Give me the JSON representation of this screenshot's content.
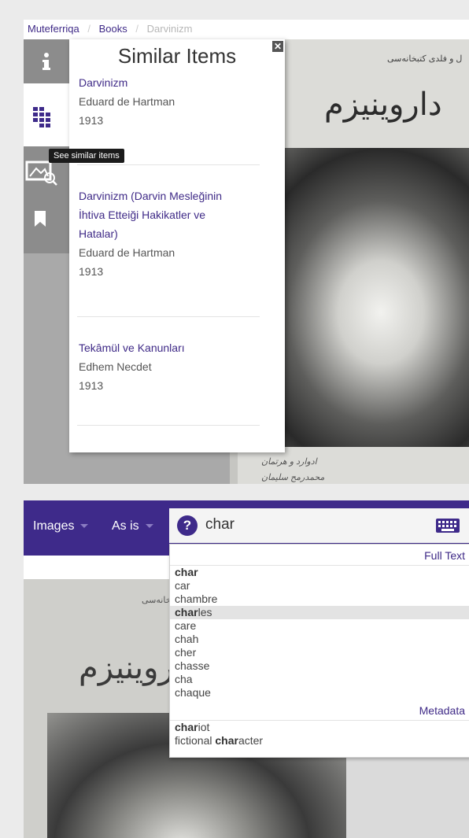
{
  "breadcrumb": {
    "home": "Muteferriqa",
    "section": "Books",
    "current": "Darvinizm",
    "separator": "/"
  },
  "sidebar": {
    "items": [
      {
        "icon": "info-icon"
      },
      {
        "icon": "similar-items-icon"
      },
      {
        "icon": "image-search-icon"
      },
      {
        "icon": "bookmark-icon"
      }
    ],
    "tooltip": "See similar items"
  },
  "similar_panel": {
    "title": "Similar Items",
    "close_label": "✕",
    "items": [
      {
        "title": "Darvinizm",
        "author": "Eduard de Hartman",
        "year": "1913"
      },
      {
        "title_lines": [
          "Darvinizm (Darvin Mesleğinin",
          "İhtiva Etteiği Hakikatler ve",
          "Hatalar)"
        ],
        "author": "Eduard de Hartman",
        "year": "1913"
      },
      {
        "title": "Tekâmül ve Kanunları",
        "author": "Edhem Necdet",
        "year": "1913"
      }
    ]
  },
  "book_page": {
    "title_arabic": "داروینیزم",
    "top_line_arabic": "ل و فلدی کتبخانه‌سی",
    "caption_line1": "ادوارد و هرتمان",
    "caption_line2": "محمدرمح سلیمان"
  },
  "toolbar": {
    "view_select": "Images",
    "mode_select": "As is",
    "help_label": "?",
    "keyboard_icon": "keyboard-icon"
  },
  "search": {
    "value": "char",
    "placeholder": "",
    "sections": [
      {
        "header": "Full Text",
        "suggestions": [
          {
            "bold": "char",
            "rest": ""
          },
          {
            "bold": "",
            "rest": "car"
          },
          {
            "bold": "",
            "rest": "chambre"
          },
          {
            "bold": "char",
            "rest": "les"
          },
          {
            "bold": "",
            "rest": "care"
          },
          {
            "bold": "",
            "rest": "chah"
          },
          {
            "bold": "",
            "rest": "cher"
          },
          {
            "bold": "",
            "rest": "chasse"
          },
          {
            "bold": "",
            "rest": "cha"
          },
          {
            "bold": "",
            "rest": "chaque"
          }
        ],
        "highlighted_index": 3
      },
      {
        "header": "Metadata",
        "suggestions": [
          {
            "prefix": "",
            "bold": "char",
            "rest": "iot"
          },
          {
            "prefix": "fictional ",
            "bold": "char",
            "rest": "acter"
          }
        ]
      }
    ]
  },
  "colors": {
    "brand": "#3e2a8a",
    "link": "#3f2a87",
    "sidebar": "#8c8c8c"
  }
}
